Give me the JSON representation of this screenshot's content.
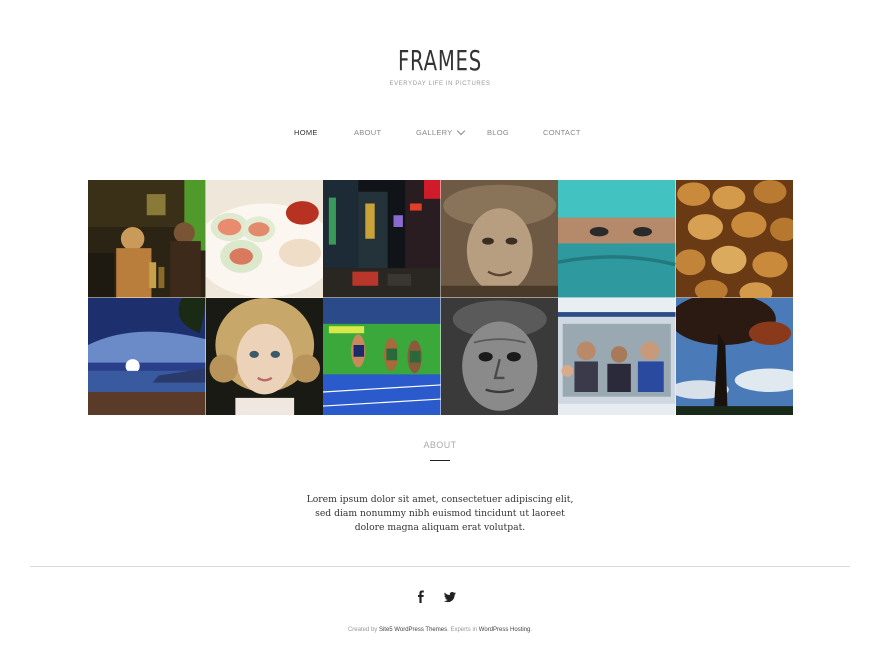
{
  "header": {
    "logo": "FRAMES",
    "tagline": "EVERYDAY LIFE IN PICTURES"
  },
  "nav": {
    "items": [
      {
        "label": "HOME",
        "active": true
      },
      {
        "label": "ABOUT"
      },
      {
        "label": "GALLERY",
        "has_dropdown": true
      },
      {
        "label": "BLOG"
      },
      {
        "label": "CONTACT"
      }
    ],
    "dropdown_icon": "chevron-down-icon"
  },
  "gallery": {
    "tiles": [
      {
        "subject": "bar-scene"
      },
      {
        "subject": "spring-rolls"
      },
      {
        "subject": "city-night"
      },
      {
        "subject": "old-woman-portrait"
      },
      {
        "subject": "veiled-face"
      },
      {
        "subject": "almonds"
      },
      {
        "subject": "sunset-beach"
      },
      {
        "subject": "curly-girl"
      },
      {
        "subject": "runners"
      },
      {
        "subject": "old-man-portrait"
      },
      {
        "subject": "bus-passengers"
      },
      {
        "subject": "tree-silhouette"
      }
    ]
  },
  "about": {
    "title": "ABOUT",
    "text": "Lorem ipsum dolor sit amet, consectetuer adipiscing elit, sed diam nonummy nibh euismod tincidunt ut laoreet dolore magna aliquam erat volutpat."
  },
  "footer": {
    "social_icons": [
      "facebook-icon",
      "twitter-icon"
    ],
    "credits": {
      "prefix": "Created by ",
      "link1": "Site5 WordPress Themes",
      "middle": ". Experts in ",
      "link2": "WordPress Hosting",
      "suffix": "."
    }
  },
  "colors": {
    "text_dark": "#333333",
    "text_muted": "#999999",
    "rule": "#d9d9d9",
    "background": "#ffffff"
  }
}
